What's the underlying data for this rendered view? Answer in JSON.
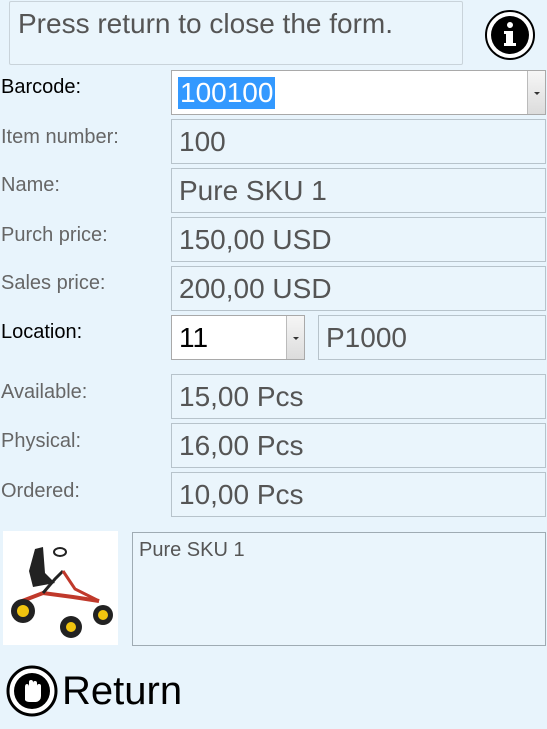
{
  "message": "Press return to close the form.",
  "icons": {
    "info": "info-icon",
    "return": "stop-hand-icon"
  },
  "fields": {
    "barcode": {
      "label": "Barcode:",
      "value": "100100"
    },
    "item_number": {
      "label": "Item number:",
      "value": "100"
    },
    "name": {
      "label": "Name:",
      "value": "Pure SKU 1"
    },
    "purch_price": {
      "label": "Purch price:",
      "value": "150,00 USD"
    },
    "sales_price": {
      "label": "Sales price:",
      "value": "200,00 USD"
    },
    "location": {
      "label": "Location:",
      "value": "11",
      "code": "P1000"
    },
    "available": {
      "label": "Available:",
      "value": "15,00 Pcs"
    },
    "physical": {
      "label": "Physical:",
      "value": "16,00 Pcs"
    },
    "ordered": {
      "label": "Ordered:",
      "value": "10,00 Pcs"
    }
  },
  "description": "Pure SKU 1",
  "return_label": "Return"
}
